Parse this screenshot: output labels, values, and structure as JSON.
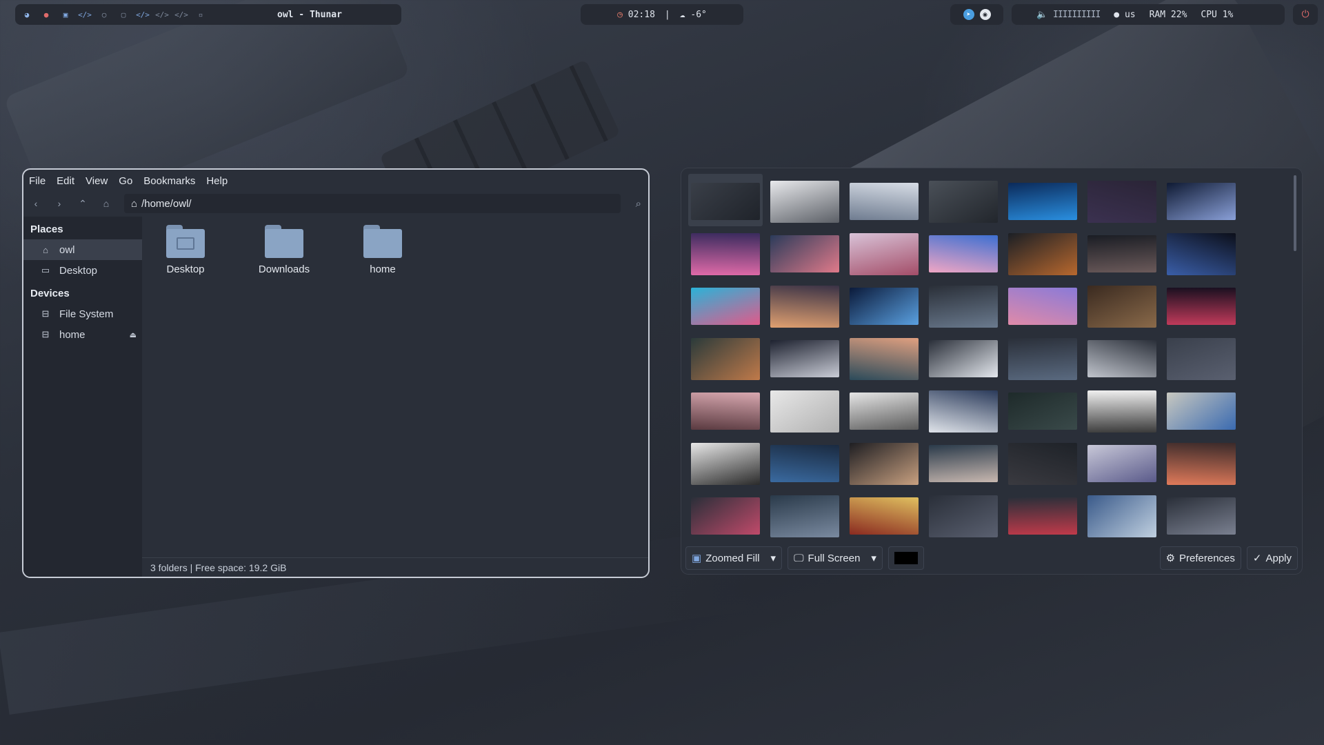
{
  "topbar": {
    "title": "owl - Thunar",
    "clock": "02:18",
    "separator": "|",
    "weather": "-6°",
    "language": "us",
    "ram": "RAM 22%",
    "cpu": "CPU  1%",
    "volume_bars": "IIIIIIIIII"
  },
  "thunar": {
    "menu": [
      "File",
      "Edit",
      "View",
      "Go",
      "Bookmarks",
      "Help"
    ],
    "path": "/home/owl/",
    "places_heading": "Places",
    "places": [
      "owl",
      "Desktop"
    ],
    "devices_heading": "Devices",
    "devices": [
      "File System",
      "home"
    ],
    "files": [
      "Desktop",
      "Downloads",
      "home"
    ],
    "status": "3 folders  |  Free space: 19.2 GiB"
  },
  "picker": {
    "mode": "Zoomed Fill",
    "screen": "Full Screen",
    "bg_color": "#000000",
    "preferences": "Preferences",
    "apply": "Apply"
  },
  "thumbnails": [
    [
      "#3a3f48",
      "#1f232a"
    ],
    [
      "#e8e9ec",
      "#5b5f66"
    ],
    [
      "#d7dde6",
      "#6f7c90"
    ],
    [
      "#4a5058",
      "#22262c"
    ],
    [
      "#0b2a5a",
      "#2a8fe0"
    ],
    [
      "#2a2436",
      "#3b3150"
    ],
    [
      "#0f1a33",
      "#8aa0d8"
    ],
    [
      "#3a2b5e",
      "#e06aa8"
    ],
    [
      "#2b3b5a",
      "#e07a8a"
    ],
    [
      "#d9c3d8",
      "#a34d68"
    ],
    [
      "#3d6fd1",
      "#f0a6c4"
    ],
    [
      "#1b1f25",
      "#b8682e"
    ],
    [
      "#1a1d24",
      "#6b5a5a"
    ],
    [
      "#0c0f1a",
      "#3a5ea8"
    ],
    [
      "#2bb3d8",
      "#e05a8a"
    ],
    [
      "#3a3246",
      "#e0a070"
    ],
    [
      "#0b1a3a",
      "#5aa0e0"
    ],
    [
      "#2a2f38",
      "#6a7a8e"
    ],
    [
      "#8a7ad8",
      "#e08aa8"
    ],
    [
      "#3a2a20",
      "#8a6a4a"
    ],
    [
      "#1a1020",
      "#c03a5a"
    ],
    [
      "#2a3a3a",
      "#c07a4a"
    ],
    [
      "#1e2230",
      "#c9ccd6"
    ],
    [
      "#e0a080",
      "#2a4a5a"
    ],
    [
      "#2a2f39",
      "#e4e8ee"
    ],
    [
      "#2a2f39",
      "#5a6a80"
    ],
    [
      "#2a2f39",
      "#c0c4cc"
    ],
    [
      "#3a404c",
      "#5a6070"
    ],
    [
      "#d8a8b0",
      "#5a3a40"
    ],
    [
      "#e8e8e8",
      "#b0b0b0"
    ],
    [
      "#e6e6e6",
      "#5a5a5a"
    ],
    [
      "#2a3a5a",
      "#e0e4ea"
    ],
    [
      "#1e2a2a",
      "#3a4a4a"
    ],
    [
      "#f0f0f0",
      "#3a3a3a"
    ],
    [
      "#c8c8c0",
      "#3a6ab0"
    ],
    [
      "#e8e8e8",
      "#2a2a2a"
    ],
    [
      "#1a2a40",
      "#3a6aa0"
    ],
    [
      "#1e1e22",
      "#c8a080"
    ],
    [
      "#2a3a4a",
      "#c8b8b0"
    ],
    [
      "#1e2228",
      "#3a3a40"
    ],
    [
      "#c8c8d8",
      "#5a5a8a"
    ],
    [
      "#3a2a2a",
      "#e07a5a"
    ],
    [
      "#2a2f39",
      "#c04a6a"
    ],
    [
      "#2a3a4a",
      "#7a8aa0"
    ],
    [
      "#e0c060",
      "#8a2a20"
    ],
    [
      "#2a2f39",
      "#5a6070"
    ],
    [
      "#2a2f39",
      "#c03a4a"
    ],
    [
      "#3a5a8a",
      "#c0d0e0"
    ],
    [
      "#2a2f39",
      "#7a8090"
    ]
  ]
}
